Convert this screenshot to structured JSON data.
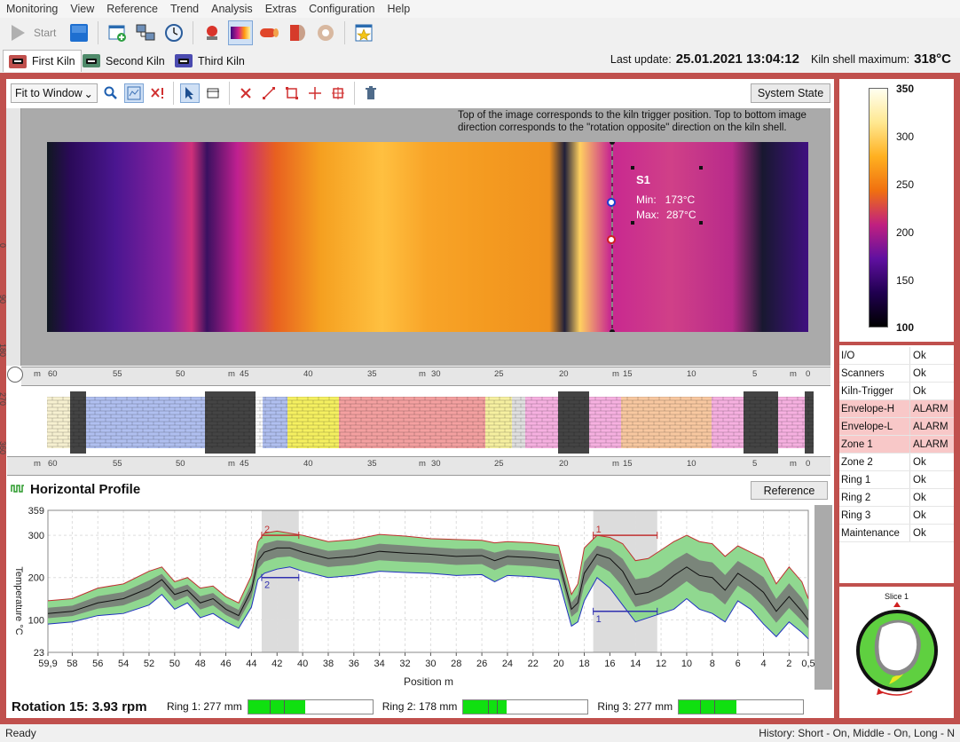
{
  "menu": [
    "Monitoring",
    "View",
    "Reference",
    "Trend",
    "Analysis",
    "Extras",
    "Configuration",
    "Help"
  ],
  "toolbar": {
    "start_label": "Start"
  },
  "tabs": [
    {
      "label": "First Kiln",
      "color": "#c0504d"
    },
    {
      "label": "Second Kiln",
      "color": "#4f8a6a"
    },
    {
      "label": "Third Kiln",
      "color": "#4b4bb0"
    }
  ],
  "header": {
    "last_update_label": "Last update:",
    "last_update_value": "25.01.2021 13:04:12",
    "shell_max_label": "Kiln shell maximum:",
    "shell_max_value": "318°C"
  },
  "view": {
    "zoom_select": "Fit to Window",
    "system_state_button": "System State",
    "note": "Top of the image corresponds to the kiln trigger position. Top to bottom image direction corresponds to the \"rotation opposite\" direction on the kiln shell.",
    "left_ruler_ticks": [
      "0",
      "90",
      "180",
      "270",
      "360"
    ],
    "top_ruler_ticks": [
      "m",
      "60",
      "55",
      "50",
      "m",
      "45",
      "40",
      "35",
      "m",
      "30",
      "25",
      "20",
      "m",
      "15",
      "10",
      "5",
      "m",
      "0"
    ]
  },
  "measurement": {
    "label": "S1",
    "min_label": "Min:",
    "min_value": "173°C",
    "max_label": "Max:",
    "max_value": "287°C"
  },
  "colorbar": {
    "ticks": [
      "350",
      "300",
      "250",
      "200",
      "150",
      "100"
    ],
    "colors": [
      "#fffff0",
      "#ffe890",
      "#ffb020",
      "#f07010",
      "#c02080",
      "#6010a0",
      "#200050",
      "#000000"
    ]
  },
  "status": [
    {
      "name": "I/O",
      "value": "Ok",
      "alarm": false
    },
    {
      "name": "Scanners",
      "value": "Ok",
      "alarm": false
    },
    {
      "name": "Kiln-Trigger",
      "value": "Ok",
      "alarm": false
    },
    {
      "name": "Envelope-H",
      "value": "ALARM",
      "alarm": true
    },
    {
      "name": "Envelope-L",
      "value": "ALARM",
      "alarm": true
    },
    {
      "name": "Zone 1",
      "value": "ALARM",
      "alarm": true
    },
    {
      "name": "Zone 2",
      "value": "Ok",
      "alarm": false
    },
    {
      "name": "Ring 1",
      "value": "Ok",
      "alarm": false
    },
    {
      "name": "Ring 2",
      "value": "Ok",
      "alarm": false
    },
    {
      "name": "Ring 3",
      "value": "Ok",
      "alarm": false
    },
    {
      "name": "Maintenance",
      "value": "Ok",
      "alarm": false
    }
  ],
  "slice": {
    "label": "Slice 1"
  },
  "profile": {
    "title": "Horizontal Profile",
    "reference_button": "Reference",
    "rotation": "Rotation 15: 3.93 rpm",
    "rings": [
      {
        "label": "Ring 1: 277 mm",
        "fraction": 0.46
      },
      {
        "label": "Ring 2: 178 mm",
        "fraction": 0.35
      },
      {
        "label": "Ring 3: 277 mm",
        "fraction": 0.46
      }
    ],
    "zone_labels": [
      "2",
      "2",
      "1",
      "1"
    ]
  },
  "chart_data": {
    "type": "line",
    "xlabel": "Position m",
    "ylabel": "Temperature °C",
    "xlim": [
      59.9,
      0.5
    ],
    "ylim": [
      23,
      359
    ],
    "x_ticks": [
      "59,9",
      "58",
      "56",
      "54",
      "52",
      "50",
      "48",
      "46",
      "44",
      "42",
      "40",
      "38",
      "36",
      "34",
      "32",
      "30",
      "28",
      "26",
      "24",
      "22",
      "20",
      "18",
      "16",
      "14",
      "12",
      "10",
      "8",
      "6",
      "4",
      "2",
      "0,5"
    ],
    "y_ticks": [
      "359",
      "300",
      "200",
      "100",
      "23"
    ],
    "x": [
      59.9,
      58,
      56,
      54,
      52,
      51,
      50,
      49,
      48,
      47,
      46,
      45,
      44,
      43.5,
      43,
      42,
      41,
      40,
      38,
      36,
      34,
      32,
      30,
      28,
      26,
      25,
      24,
      22,
      20,
      19,
      18.5,
      18,
      17,
      16,
      15,
      14,
      13,
      12,
      11,
      10,
      9,
      8,
      7,
      6,
      5,
      4,
      3,
      2,
      1,
      0.5
    ],
    "series": [
      {
        "name": "",
        "values": [
          115,
          120,
          140,
          150,
          175,
          195,
          160,
          170,
          140,
          150,
          125,
          110,
          170,
          240,
          260,
          270,
          270,
          260,
          245,
          250,
          262,
          258,
          255,
          250,
          252,
          240,
          250,
          247,
          240,
          125,
          140,
          210,
          255,
          245,
          215,
          160,
          165,
          180,
          205,
          225,
          205,
          200,
          170,
          210,
          190,
          165,
          120,
          155,
          120,
          100
        ]
      },
      {
        "name": "",
        "values": [
          145,
          150,
          175,
          185,
          215,
          225,
          190,
          200,
          175,
          180,
          155,
          140,
          205,
          285,
          305,
          310,
          305,
          300,
          285,
          290,
          302,
          298,
          292,
          290,
          288,
          282,
          285,
          282,
          275,
          160,
          185,
          270,
          300,
          295,
          280,
          240,
          245,
          265,
          285,
          300,
          285,
          280,
          250,
          275,
          260,
          245,
          185,
          225,
          190,
          150
        ]
      },
      {
        "name": "",
        "values": [
          90,
          95,
          110,
          115,
          135,
          160,
          125,
          140,
          105,
          115,
          95,
          80,
          130,
          195,
          210,
          220,
          225,
          215,
          200,
          205,
          215,
          212,
          210,
          205,
          207,
          190,
          205,
          202,
          195,
          85,
          95,
          145,
          200,
          175,
          135,
          95,
          105,
          115,
          125,
          150,
          125,
          115,
          95,
          145,
          125,
          90,
          60,
          95,
          70,
          55
        ]
      }
    ]
  }
}
